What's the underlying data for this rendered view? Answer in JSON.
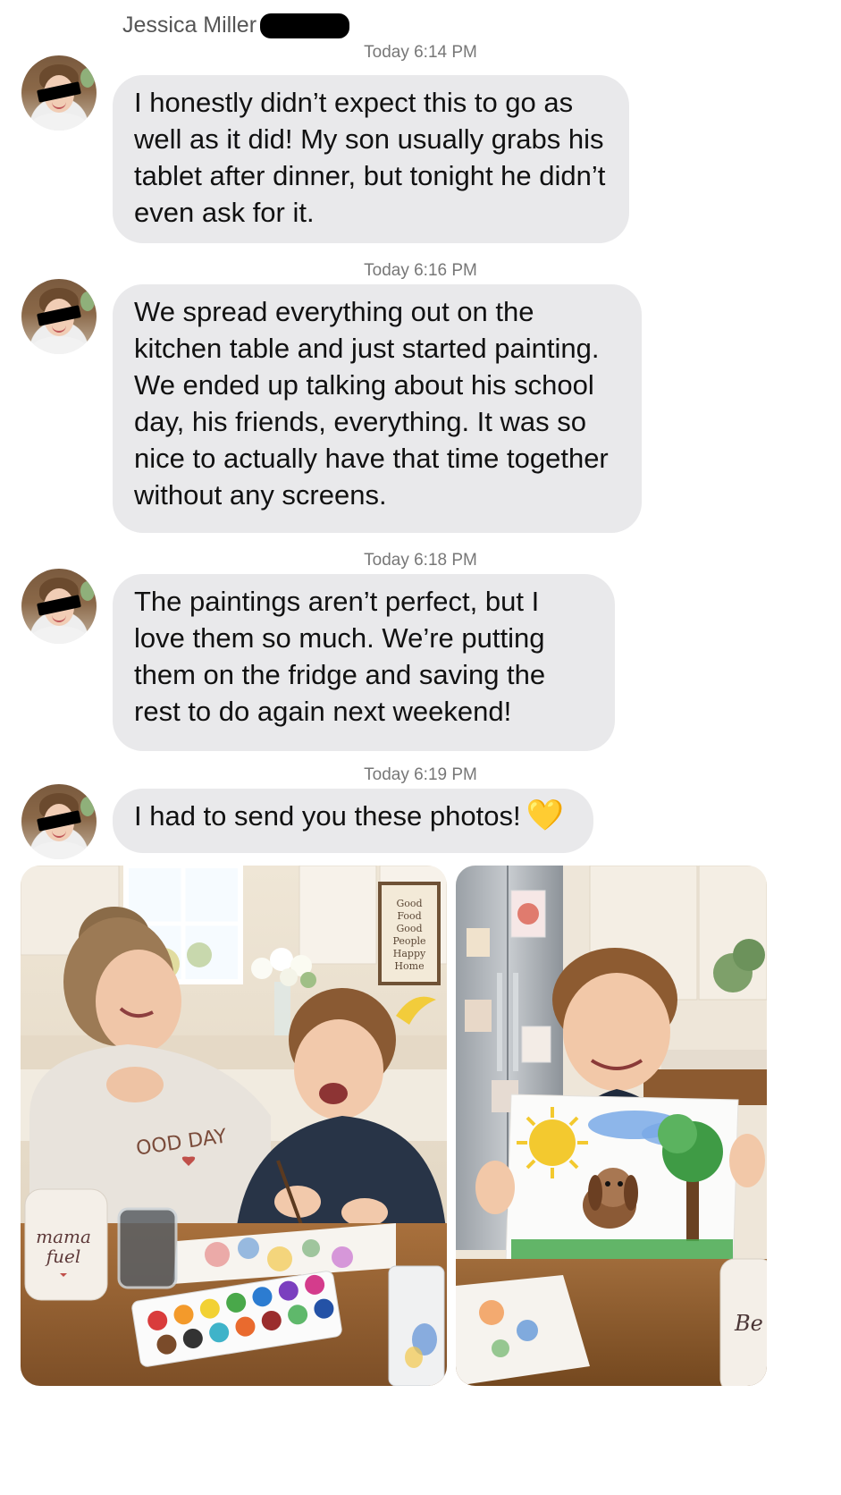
{
  "contact": {
    "name": "Jessica Miller"
  },
  "messages": [
    {
      "timestamp": "Today 6:14 PM",
      "text": "I honestly didn’t expect this to go as well as it did! My son usually grabs his tablet after dinner, but tonight he didn’t even ask for it."
    },
    {
      "timestamp": "Today 6:16 PM",
      "text": "We spread everything out on the kitchen table and just started painting. We ended up talking about his school day, his friends, everything. It was so nice to actually have that time together without any screens."
    },
    {
      "timestamp": "Today 6:18 PM",
      "text": "The paintings aren’t perfect, but I love them so much. We’re putting them on the fridge and saving the rest to do again next weekend!"
    },
    {
      "timestamp": "Today 6:19 PM",
      "text": "I had to send you these photos!",
      "emoji": "💛"
    }
  ],
  "photos": {
    "left": {
      "sign_lines": [
        "Good",
        "Food",
        "Good",
        "People",
        "Happy",
        "Home"
      ],
      "shirt_text": "OOD DAY",
      "mug_text": [
        "mama",
        "fuel"
      ]
    },
    "right": {
      "mug_text": "Be"
    }
  },
  "colors": {
    "bubble": "#e9e9eb",
    "timestamp": "#777777",
    "heart": "#f2b51b"
  }
}
